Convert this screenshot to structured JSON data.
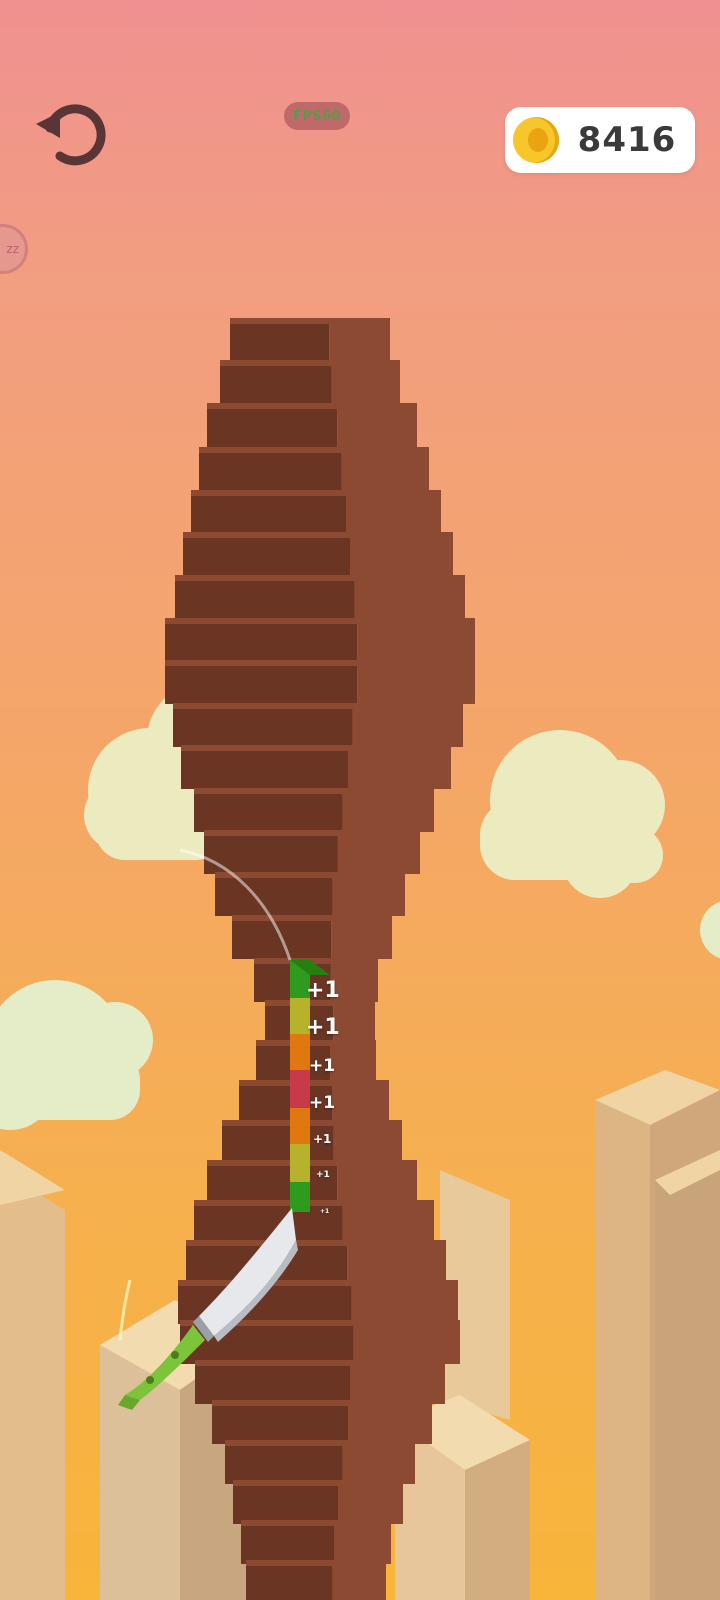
{
  "hud": {
    "fps_label": "FPS60",
    "coin_count": "8416",
    "side_button_label": "zz"
  },
  "score_popups": [
    "+1",
    "+1",
    "+1",
    "+1",
    "+1",
    "+1",
    "+1"
  ],
  "icons": {
    "restart": "restart-icon",
    "coin": "coin-icon"
  },
  "colors": {
    "wood_light": "#8c4a33",
    "wood_dark": "#6b3524",
    "coin": "#f7c62a"
  }
}
